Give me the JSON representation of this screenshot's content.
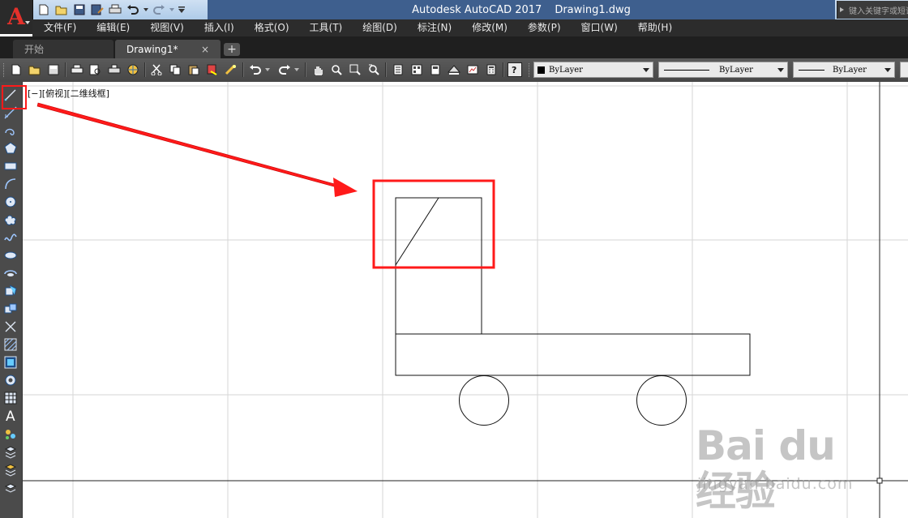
{
  "window": {
    "app_name": "Autodesk AutoCAD 2017",
    "file_name": "Drawing1.dwg",
    "search_placeholder": "键入关键字或短语"
  },
  "menu": {
    "items": [
      "文件(F)",
      "编辑(E)",
      "视图(V)",
      "插入(I)",
      "格式(O)",
      "工具(T)",
      "绘图(D)",
      "标注(N)",
      "修改(M)",
      "参数(P)",
      "窗口(W)",
      "帮助(H)"
    ]
  },
  "tabs": {
    "start": "开始",
    "drawing": "Drawing1*",
    "close_glyph": "×",
    "add_glyph": "+"
  },
  "properties": {
    "color": "ByLayer",
    "linetype": "ByLayer",
    "lineweight": "ByLayer"
  },
  "viewport": {
    "label": "[−][俯视][二维线框]"
  },
  "left_tools": [
    "line-icon",
    "construction-line-icon",
    "polyline-icon",
    "polygon-icon",
    "rectangle-icon",
    "arc-icon",
    "circle-icon",
    "revision-cloud-icon",
    "spline-icon",
    "ellipse-icon",
    "ellipse-arc-icon",
    "insert-block-icon",
    "make-block-icon",
    "point-icon",
    "hatch-icon",
    "gradient-icon",
    "region-icon",
    "table-icon",
    "multiline-text-icon",
    "add-selected-icon",
    "layer-icon-1",
    "layer-icon-2",
    "layer-icon-3"
  ],
  "watermark": {
    "logo": "Bai du 经验",
    "site": "jingyan.baidu.com"
  },
  "colors": {
    "annotation_red": "#ff1a1a",
    "menubar_bg": "#2c2c2c",
    "title_bg": "#3e5f8e"
  }
}
